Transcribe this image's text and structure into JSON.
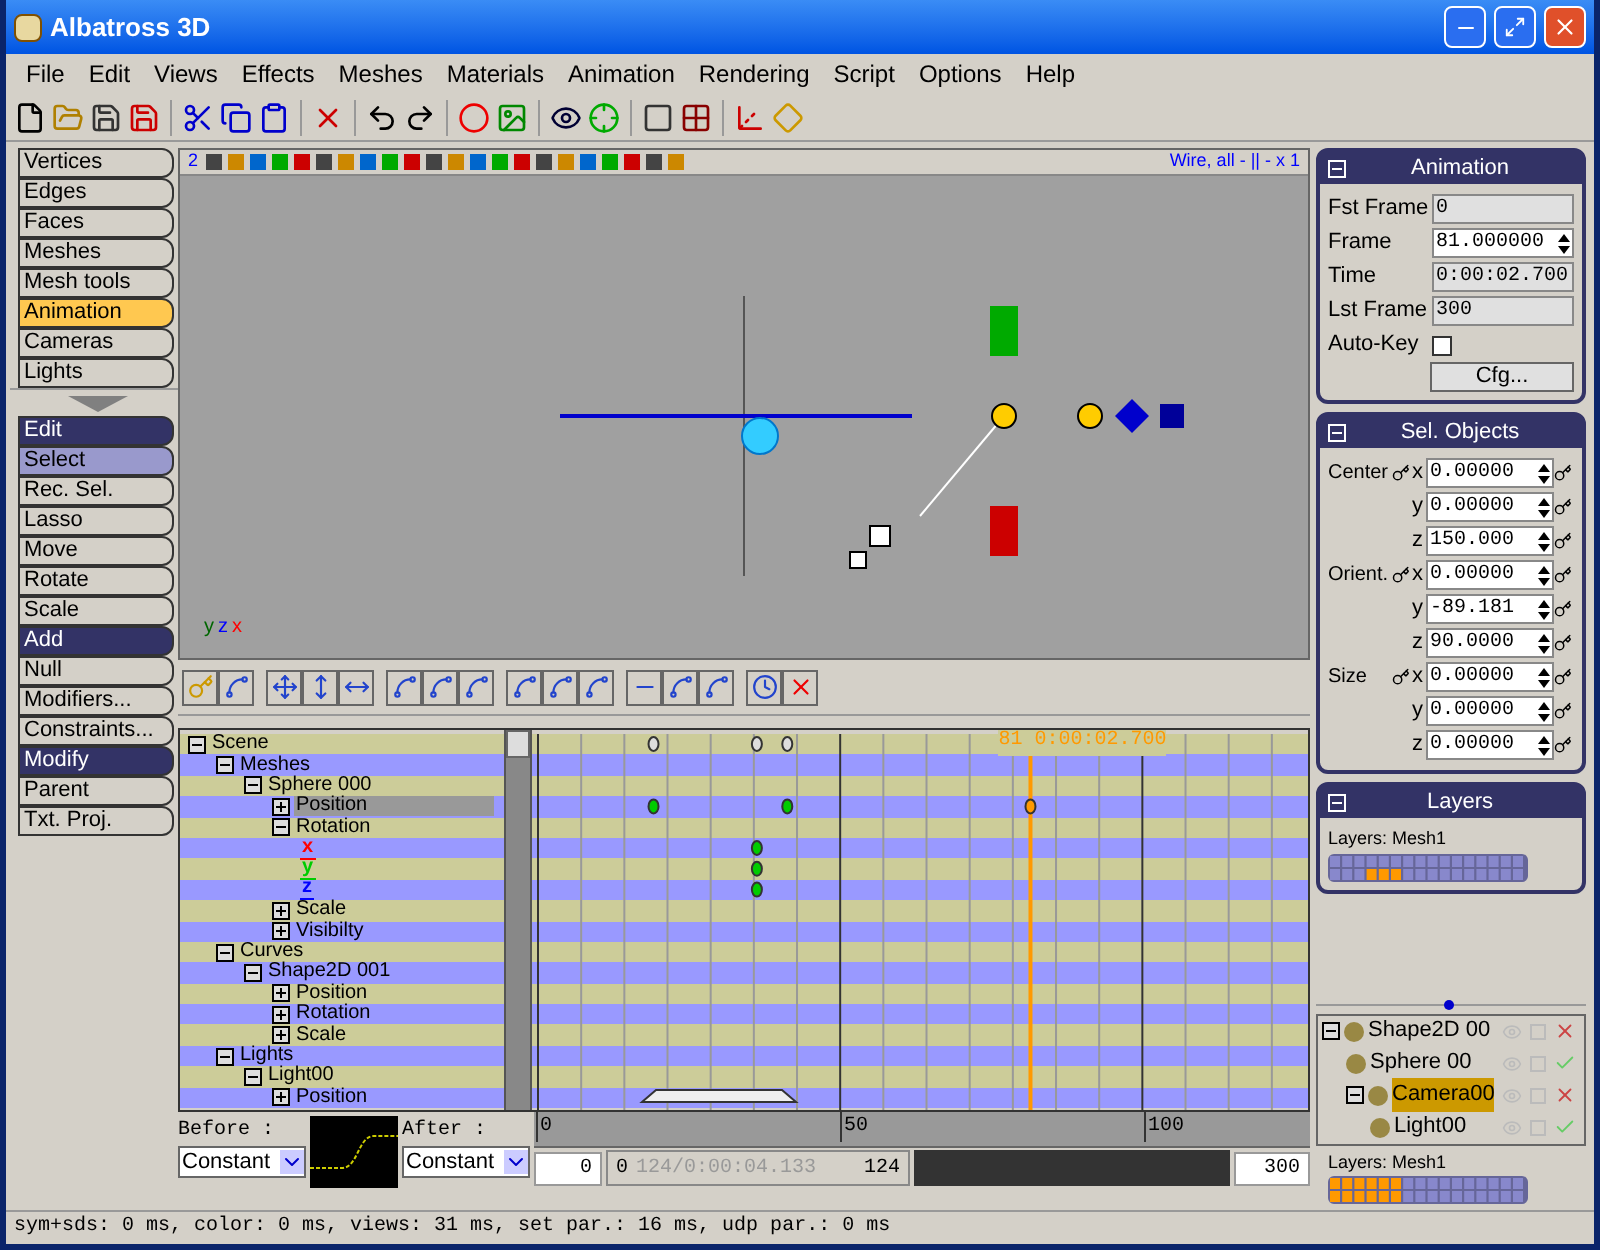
{
  "window": {
    "title": "Albatross 3D"
  },
  "menu": [
    "File",
    "Edit",
    "Views",
    "Effects",
    "Meshes",
    "Materials",
    "Animation",
    "Rendering",
    "Script",
    "Options",
    "Help"
  ],
  "left_panel": [
    {
      "label": "Vertices",
      "kind": "mode",
      "selected": false
    },
    {
      "label": "Edges",
      "kind": "mode",
      "selected": false
    },
    {
      "label": "Faces",
      "kind": "mode",
      "selected": false
    },
    {
      "label": "Meshes",
      "kind": "mode",
      "selected": false
    },
    {
      "label": "Mesh tools",
      "kind": "mode",
      "selected": false
    },
    {
      "label": "Animation",
      "kind": "mode",
      "selected": true
    },
    {
      "label": "Cameras",
      "kind": "mode",
      "selected": false
    },
    {
      "label": "Lights",
      "kind": "mode",
      "selected": false
    },
    {
      "kind": "separator"
    },
    {
      "label": "Edit",
      "kind": "header"
    },
    {
      "label": "Select",
      "kind": "tool",
      "selected": true
    },
    {
      "label": "Rec. Sel.",
      "kind": "tool",
      "selected": false
    },
    {
      "label": "Lasso",
      "kind": "tool",
      "selected": false
    },
    {
      "label": "Move",
      "kind": "tool",
      "selected": false
    },
    {
      "label": "Rotate",
      "kind": "tool",
      "selected": false
    },
    {
      "label": "Scale",
      "kind": "tool",
      "selected": false
    },
    {
      "label": "Add",
      "kind": "header"
    },
    {
      "label": "Null",
      "kind": "tool",
      "selected": false
    },
    {
      "label": "Modifiers...",
      "kind": "tool",
      "selected": false
    },
    {
      "label": "Constraints...",
      "kind": "tool",
      "selected": false
    },
    {
      "label": "Modify",
      "kind": "header"
    },
    {
      "label": "Parent",
      "kind": "tool",
      "selected": false
    },
    {
      "label": "Txt. Proj.",
      "kind": "tool",
      "selected": false
    }
  ],
  "viewport": {
    "number": "2",
    "mode": "Wire, all - || - x 1",
    "axis_labels": [
      {
        "text": "y",
        "color": "#006600"
      },
      {
        "text": "z",
        "color": "#0000ff"
      },
      {
        "text": "x",
        "color": "#ff0000"
      }
    ]
  },
  "tree": [
    {
      "label": "Scene",
      "expanded": true,
      "selected": false,
      "children": [
        {
          "label": "Meshes",
          "expanded": true,
          "selected": false,
          "children": [
            {
              "label": "Sphere 000",
              "expanded": true,
              "selected": false,
              "children": [
                {
                  "label": "Position",
                  "expanded": false,
                  "selected": true
                },
                {
                  "label": "Rotation",
                  "expanded": true,
                  "selected": false,
                  "children": [
                    {
                      "label": "x",
                      "color": "#ff0000",
                      "selected": false
                    },
                    {
                      "label": "y",
                      "color": "#00cc00",
                      "selected": false
                    },
                    {
                      "label": "z",
                      "color": "#0000ff",
                      "selected": false
                    }
                  ]
                },
                {
                  "label": "Scale",
                  "expanded": false,
                  "selected": false
                },
                {
                  "label": "Visibilty",
                  "expanded": false,
                  "selected": false
                }
              ]
            }
          ]
        },
        {
          "label": "Curves",
          "expanded": true,
          "selected": false,
          "children": [
            {
              "label": "Shape2D 001",
              "expanded": true,
              "selected": false,
              "children": [
                {
                  "label": "Position",
                  "expanded": false,
                  "selected": false
                },
                {
                  "label": "Rotation",
                  "expanded": false,
                  "selected": false
                },
                {
                  "label": "Scale",
                  "expanded": false,
                  "selected": false
                }
              ]
            }
          ]
        },
        {
          "label": "Lights",
          "expanded": true,
          "selected": false,
          "children": [
            {
              "label": "Light00",
              "expanded": true,
              "selected": false,
              "children": [
                {
                  "label": "Position",
                  "expanded": false,
                  "selected": false
                }
              ]
            }
          ]
        }
      ]
    }
  ],
  "timeline": {
    "current_label": "81 0:00:02.700",
    "ruler": [
      "0",
      "50",
      "100"
    ],
    "start": "0",
    "range_start": "0",
    "range_info": "124/0:00:04.133",
    "range_end": "124",
    "end": "300"
  },
  "before": {
    "label": "Before :",
    "value": "Constant"
  },
  "after": {
    "label": "After :",
    "value": "Constant"
  },
  "animation_panel": {
    "title": "Animation",
    "fields": [
      {
        "label": "Fst Frame",
        "value": "0",
        "kind": "plain"
      },
      {
        "label": "Frame",
        "value": "81.000000",
        "kind": "spin"
      },
      {
        "label": "Time",
        "value": "0:00:02.700",
        "kind": "plain"
      },
      {
        "label": "Lst Frame",
        "value": "300",
        "kind": "plain"
      }
    ],
    "auto_key": {
      "label": "Auto-Key",
      "checked": false
    },
    "cfg_button": "Cfg..."
  },
  "sel_objects": {
    "title": "Sel. Objects",
    "rows": [
      {
        "label": "Center",
        "axis": "x",
        "value": "0.00000"
      },
      {
        "axis": "y",
        "value": "0.00000"
      },
      {
        "axis": "z",
        "value": "150.000"
      },
      {
        "label": "Orient.",
        "axis": "x",
        "value": "0.00000"
      },
      {
        "axis": "y",
        "value": "-89.181"
      },
      {
        "axis": "z",
        "value": "90.0000"
      },
      {
        "label": "Size",
        "axis": "x",
        "value": "0.00000"
      },
      {
        "axis": "y",
        "value": "0.00000"
      },
      {
        "axis": "z",
        "value": "0.00000"
      }
    ]
  },
  "layers_panel": {
    "title": "Layers",
    "label": "Layers: Mesh1"
  },
  "objects": [
    {
      "name": "Shape2D 00",
      "expanded": true,
      "selected": false,
      "render": false,
      "children": [
        {
          "name": "Sphere 00",
          "selected": false,
          "render": true
        },
        {
          "name": "Camera00",
          "expanded": true,
          "selected": true,
          "render": false,
          "children": [
            {
              "name": "Light00",
              "selected": false,
              "render": true
            }
          ]
        }
      ]
    }
  ],
  "objects_layers_label": "Layers: Mesh1",
  "status_bar": "sym+sds: 0 ms, color: 0 ms, views: 31 ms, set par.: 16 ms, udp par.: 0 ms"
}
